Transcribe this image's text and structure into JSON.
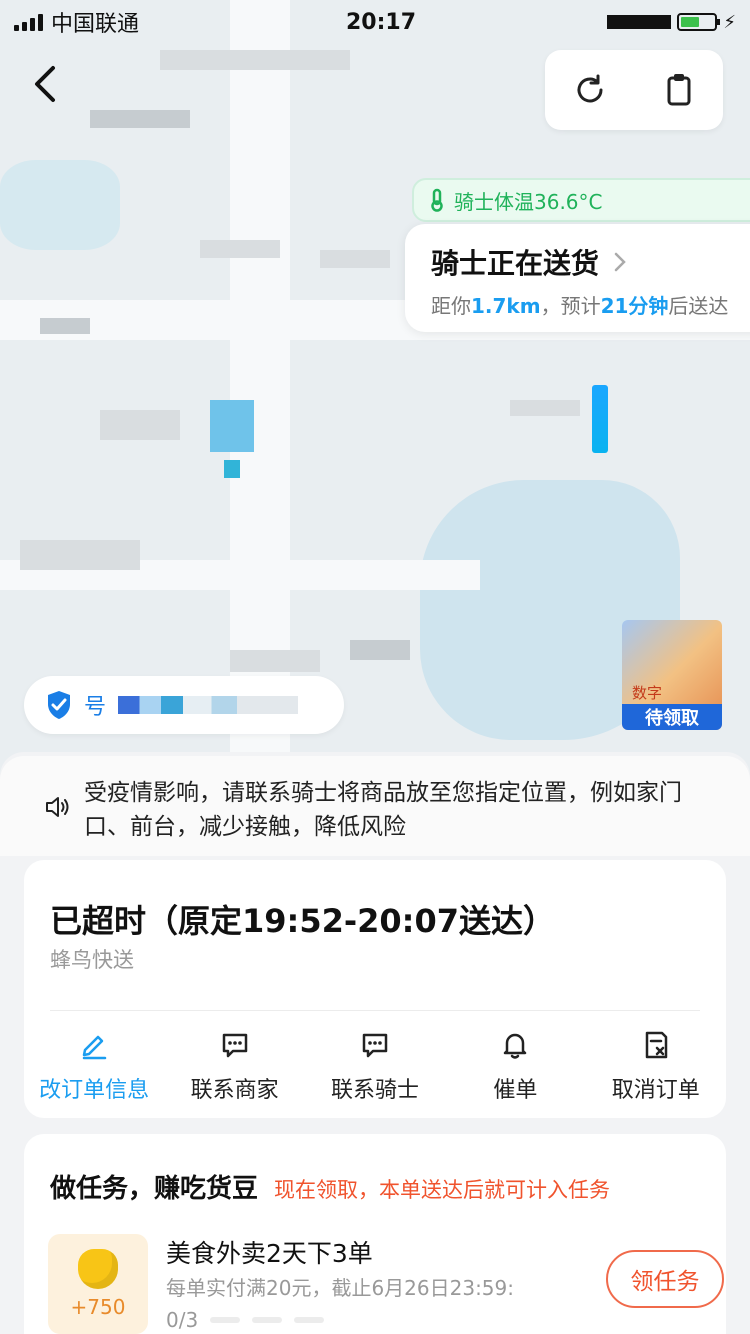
{
  "status_bar": {
    "carrier": "中国联通",
    "time": "20:17"
  },
  "map": {
    "temperature": "骑士体温36.6°C",
    "rider_status_title": "骑士正在送货",
    "rider_distance_prefix": "距你",
    "rider_distance": "1.7km",
    "rider_eta_prefix": "，预计",
    "rider_eta": "21分钟",
    "rider_eta_suffix": "后送达",
    "id_pill_label": "号",
    "promo_badge": "待领取",
    "promo_top_text": "数字"
  },
  "notice": {
    "text": "受疫情影响，请联系骑士将商品放至您指定位置，例如家门口、前台，减少接触，降低风险"
  },
  "order_status": {
    "headline": "已超时（原定19:52-20:07送达）",
    "carrier": "蜂鸟快送",
    "actions": [
      {
        "label": "改订单信息",
        "icon": "edit-icon"
      },
      {
        "label": "联系商家",
        "icon": "chat-icon"
      },
      {
        "label": "联系骑士",
        "icon": "chat-icon"
      },
      {
        "label": "催单",
        "icon": "bell-icon"
      },
      {
        "label": "取消订单",
        "icon": "cancel-order-icon"
      }
    ]
  },
  "tasks": {
    "title": "做任务，赚吃货豆",
    "tip": "现在领取，本单送达后就可计入任务",
    "item": {
      "points": "+750",
      "title": "美食外卖2天下3单",
      "desc": "每单实付满20元，截止6月26日23:59:",
      "progress": "0/3",
      "button": "领任务"
    }
  },
  "colors": {
    "accent_blue": "#1a9df0",
    "alert_red": "#f0532d",
    "temp_green": "#20b25a"
  }
}
